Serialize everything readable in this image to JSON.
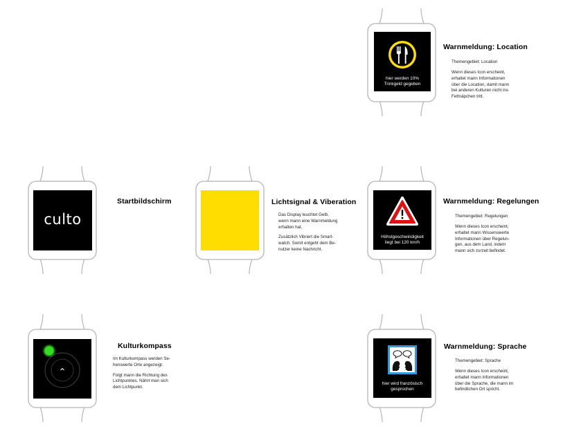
{
  "colors": {
    "warning_yellow": "#FFDD00",
    "compass_green": "#33dd22",
    "screen_black": "#000000",
    "sign_blue": "#3399dd",
    "sign_red": "#dd1111"
  },
  "start": {
    "title": "Startbildschirm",
    "logo": "culto"
  },
  "signal": {
    "title": "Lichtsignal & Viberation",
    "paragraphs": [
      "Das Display leuchtet Gelb,\nwenn mann eine Warnmeldung\nerhalten hat.",
      "Zusätzlich Vibriert die Smart-\nwatch. Somit entgeht dem Be-\nnutzer keine Nachricht."
    ]
  },
  "compass": {
    "title": "Kulturkompass",
    "icon": "chevron-up-icon",
    "paragraphs": [
      "Im Kulturkompass werden Se-\nhenswerte Orte angezeigt.",
      "Folgt mann die Richtung des\nLichtpunktes. Nährt man sich\ndem Lichtpunkt."
    ]
  },
  "location": {
    "title": "Warnmeldung: Location",
    "topic": "Themengebiet: Location",
    "icon": "fork-knife-icon",
    "screen_text": "hier werden 10%\nTrinkgeld gegeben",
    "paragraphs": [
      "Wenn dieses Icon erscheint,\nerhaltet mann Informationen\nüber die Location, damit mann\nbei anderen Kulturen nicht ins\nFettnäpchen tritt."
    ]
  },
  "rules": {
    "title": "Warnmeldung: Regelungen",
    "topic": "Themengebiet: Regelungen",
    "icon": "warning-triangle-icon",
    "screen_text": "Höhstgeschwindigkeit\nliegt bei 120 km/h",
    "paragraphs": [
      "Wenn dieses Icon erscheint,\nerhaltet mann Wissenswerte\nInformationen über Regelun-\ngen, aus dem Land, indem\nmann sich zurzeit befindet."
    ]
  },
  "language": {
    "title": "Warnmeldung: Sprache",
    "topic": "Themengebiet: Sprache",
    "icon": "speaking-heads-icon",
    "screen_text": "hier wird französisch\ngesprochen",
    "paragraphs": [
      "Wenn dieses Icon erscheint,\nerhaltet mann Informationen\nüber die Sprache, die mann im\nbefindlichen Ort spricht."
    ]
  }
}
